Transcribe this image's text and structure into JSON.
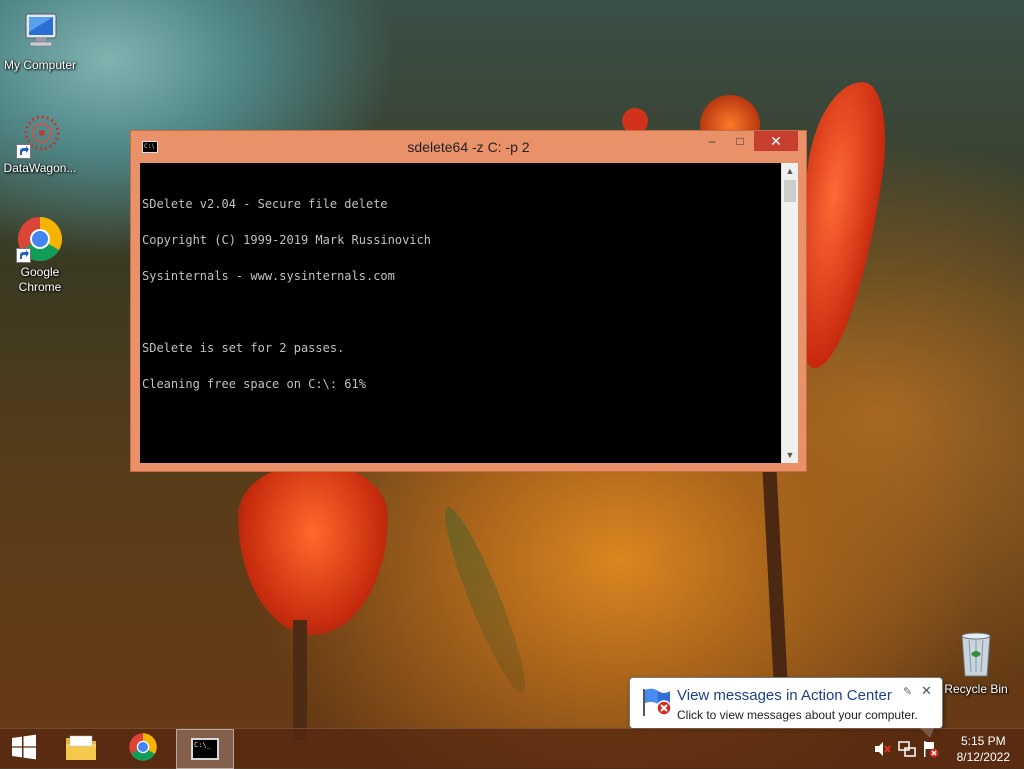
{
  "desktop": {
    "icons": [
      {
        "label": "My Computer",
        "icon": "my-computer-icon"
      },
      {
        "label": "DataWagon...",
        "icon": "datawagon-icon"
      },
      {
        "label": "Google Chrome",
        "icon": "chrome-icon"
      }
    ],
    "recycle_bin": {
      "label": "Recycle Bin",
      "icon": "recycle-bin-icon"
    }
  },
  "console_window": {
    "title": "sdelete64  -z C: -p 2",
    "icon": "cmd-icon",
    "controls": {
      "minimize": "–",
      "maximize": "□",
      "close": "✕"
    },
    "lines": [
      "SDelete v2.04 - Secure file delete",
      "Copyright (C) 1999-2019 Mark Russinovich",
      "Sysinternals - www.sysinternals.com",
      "",
      "SDelete is set for 2 passes.",
      "Cleaning free space on C:\\: 61%"
    ]
  },
  "notification": {
    "title": "View messages in Action Center",
    "text": "Click to view messages about your computer.",
    "icon": "action-center-flag-icon"
  },
  "taskbar": {
    "items": [
      {
        "name": "start",
        "icon": "windows-logo-icon"
      },
      {
        "name": "file-explorer",
        "icon": "folder-icon"
      },
      {
        "name": "chrome",
        "icon": "chrome-icon"
      },
      {
        "name": "command-prompt",
        "icon": "cmd-icon",
        "active": true
      }
    ],
    "tray": [
      "volume-muted-icon",
      "network-icon",
      "action-center-flag-icon"
    ],
    "clock": {
      "time": "5:15 PM",
      "date": "8/12/2022"
    }
  }
}
